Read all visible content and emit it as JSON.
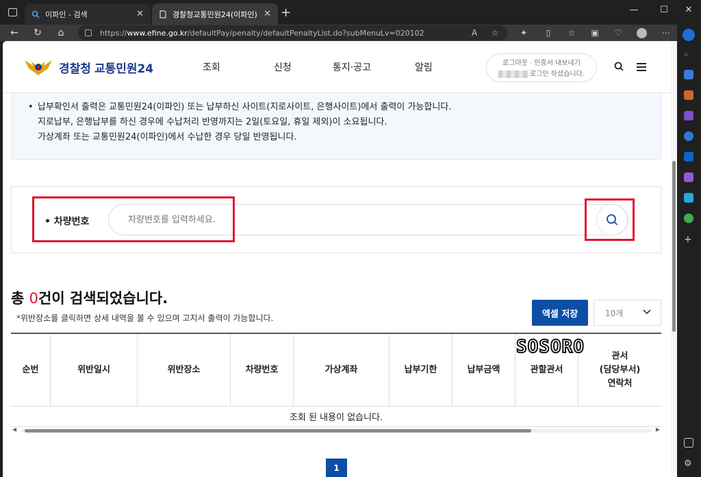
{
  "browser": {
    "tabs": [
      {
        "title": "이파인 - 검색",
        "active": false
      },
      {
        "title": "경찰청교통민원24(이파인)",
        "active": true
      }
    ],
    "url_prefix": "https://",
    "url_host": "www.efine.go.kr",
    "url_path": "/defaultPay/penalty/defaultPenaltyList.do?subMenuLv=020102"
  },
  "site": {
    "logo_main": "경찰청",
    "logo_sub": "교통민원24",
    "nav": [
      "조회",
      "신청",
      "통지·공고",
      "알림"
    ],
    "login_line1": "로그아웃 · 인증서 내보내기",
    "login_line2": "로그인 하셨습니다."
  },
  "notice": {
    "line1": "납부확인서 출력은 교통민원24(이파인) 또는 납부하신 사이트(지로사이트, 은행사이트)에서 출력이 가능합니다.",
    "line2": "지로납부, 은행납부를 하신 경우에 수납처리 반영까지는 2일(토요일, 휴일 제외)이 소요됩니다.",
    "line3": "가상계좌 또는 교통민원24(이파인)에서 수납한 경우 당일 반영됩니다."
  },
  "search": {
    "label": "• 차량번호",
    "placeholder": "차량번호를 입력하세요."
  },
  "results": {
    "prefix": "총 ",
    "count": "0",
    "suffix": "건이 검색되었습니다.",
    "note": "*위반장소를 클릭하면 상세 내역을 볼 수 있으며 고지서 출력이 가능합니다.",
    "excel_label": "엑셀 저장",
    "page_size": "10개"
  },
  "table": {
    "headers": [
      "순번",
      "위반일시",
      "위반장소",
      "차량번호",
      "가상계좌",
      "납부기한",
      "납부금액",
      "관할관서",
      "관서\n(담당부서)\n연락처"
    ],
    "empty_message": "조회 된 내용이 없습니다."
  },
  "pagination": {
    "current": "1"
  },
  "watermark": "SOSORO",
  "colors": {
    "brand_blue": "#0d4ea6",
    "highlight_red": "#e3102a",
    "count_red": "#e3102a"
  }
}
